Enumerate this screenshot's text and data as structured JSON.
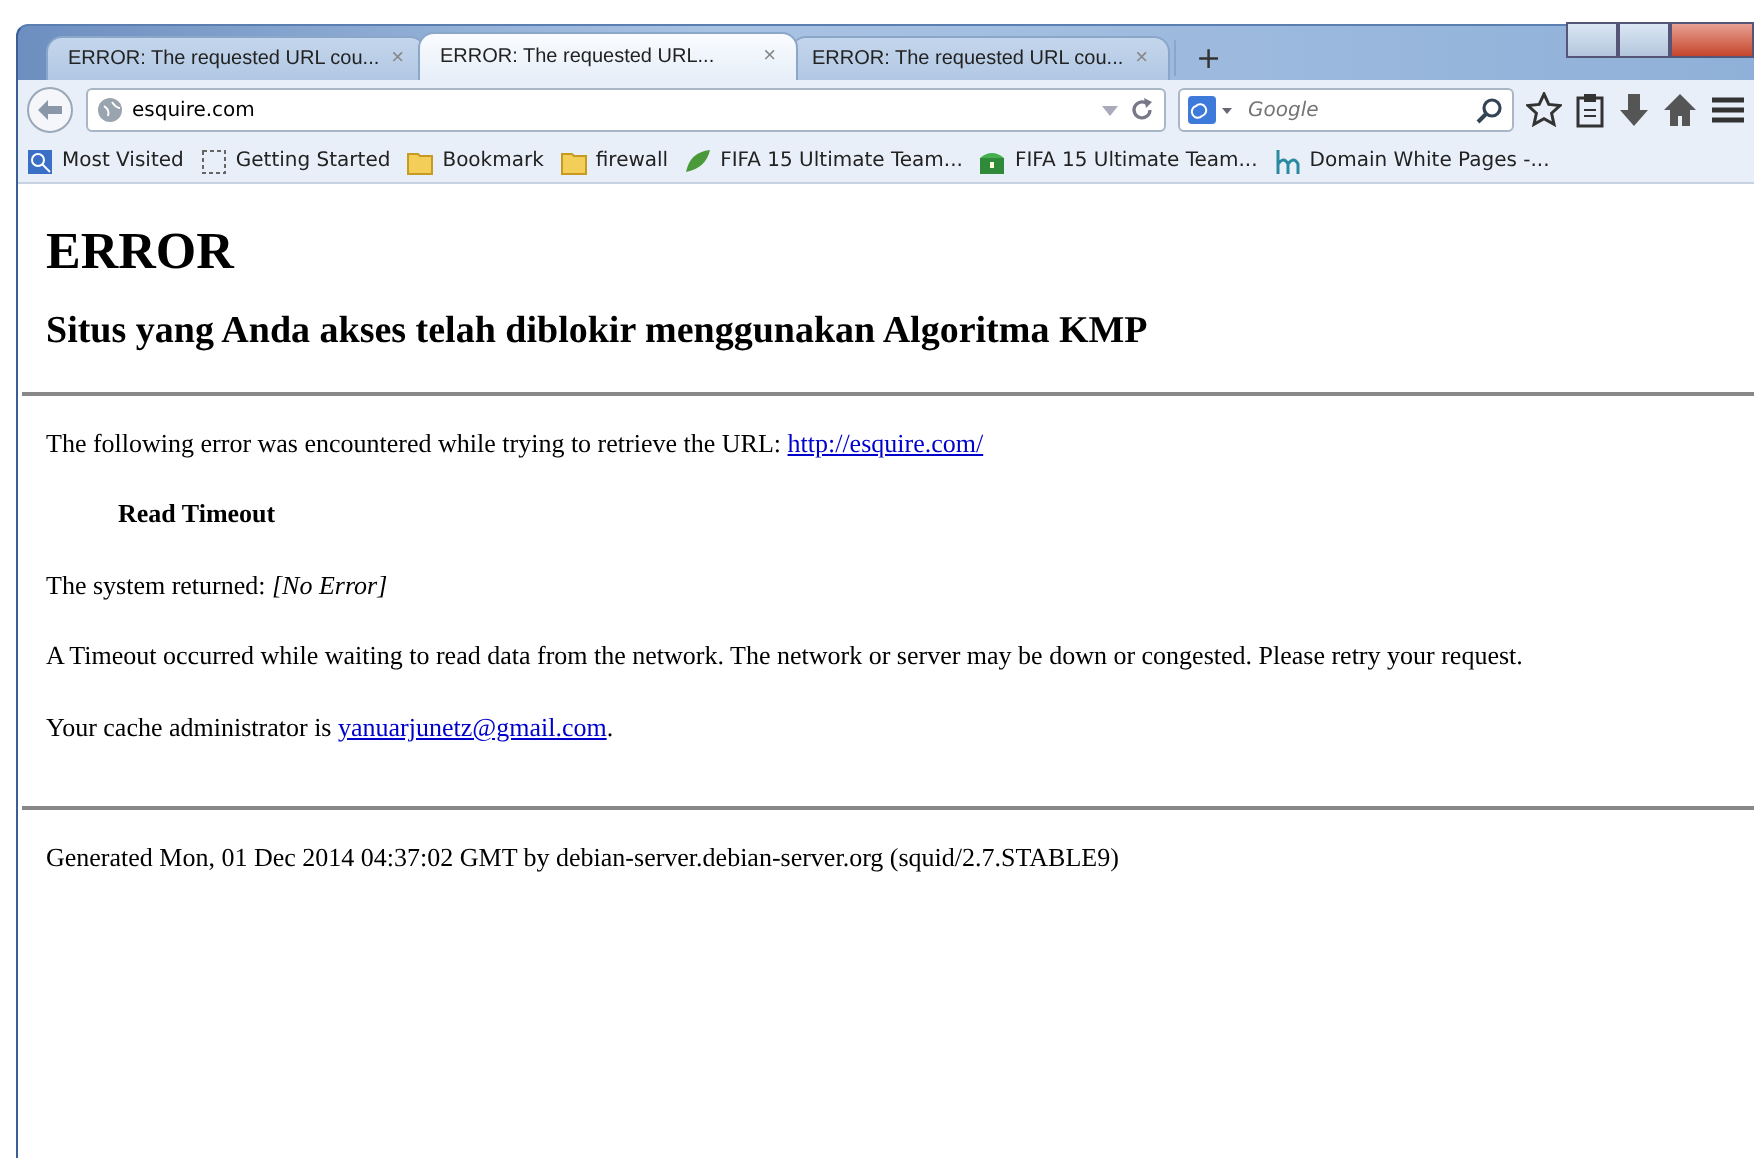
{
  "tabs": [
    {
      "title": "ERROR: The requested URL cou...",
      "close": "×",
      "selected": false
    },
    {
      "title": "ERROR: The requested URL...",
      "close": "×",
      "selected": true
    },
    {
      "title": "ERROR: The requested URL cou...",
      "close": "×",
      "selected": false
    }
  ],
  "new_tab": "+",
  "address": "esquire.com",
  "search": {
    "placeholder": "Google"
  },
  "bookmarks": [
    {
      "label": "Most Visited",
      "kind": "history"
    },
    {
      "label": "Getting Started",
      "kind": "page"
    },
    {
      "label": "Bookmark",
      "kind": "folder"
    },
    {
      "label": "firewall",
      "kind": "folder"
    },
    {
      "label": "FIFA 15 Ultimate Team...",
      "kind": "leaf"
    },
    {
      "label": "FIFA 15 Ultimate Team...",
      "kind": "chest"
    },
    {
      "label": "Domain White Pages -...",
      "kind": "hm"
    }
  ],
  "page": {
    "heading": "ERROR",
    "subheading": "Situs yang Anda akses telah diblokir menggunakan Algoritma KMP",
    "intro": {
      "text": "The following error was encountered while trying to retrieve the URL: ",
      "link": "http://esquire.com/"
    },
    "error_name": "Read Timeout",
    "system_returned": "The system returned: *[No Error]*",
    "description": "A Timeout occurred while waiting to read data from the network. The network or server may be down or congested. Please retry your request.",
    "admin": {
      "text": "Your cache administrator is ",
      "link": "yanuarjunetz@gmail.com",
      "after": "."
    },
    "footer": "Generated Mon, 01 Dec 2014 04:37:02 GMT by debian-server.debian-server.org (squid/2.7.STABLE9)"
  }
}
